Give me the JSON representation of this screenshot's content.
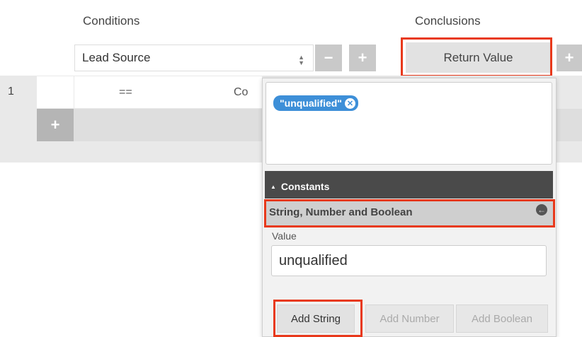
{
  "headers": {
    "conditions": "Conditions",
    "conclusions": "Conclusions"
  },
  "condition_row": {
    "field_select": "Lead Source",
    "remove_label": "−",
    "add_label": "+",
    "return_value_label": "Return Value",
    "add_conclusion_label": "+"
  },
  "table": {
    "row_number": "1",
    "operator": "==",
    "value_partial": "Co",
    "add_row_label": "+"
  },
  "popup": {
    "expression_token": "\"unqualified\"",
    "section_title": "Constants",
    "section_caret": "▲",
    "subsection_title": "String, Number and Boolean",
    "value_label": "Value",
    "value_input": "unqualified",
    "buttons": {
      "add_string": "Add String",
      "add_number": "Add Number",
      "add_boolean": "Add Boolean"
    }
  },
  "colors": {
    "highlight": "#e8391b",
    "token_blue": "#3d8fd8",
    "constants_bar": "#4a4a4a"
  }
}
